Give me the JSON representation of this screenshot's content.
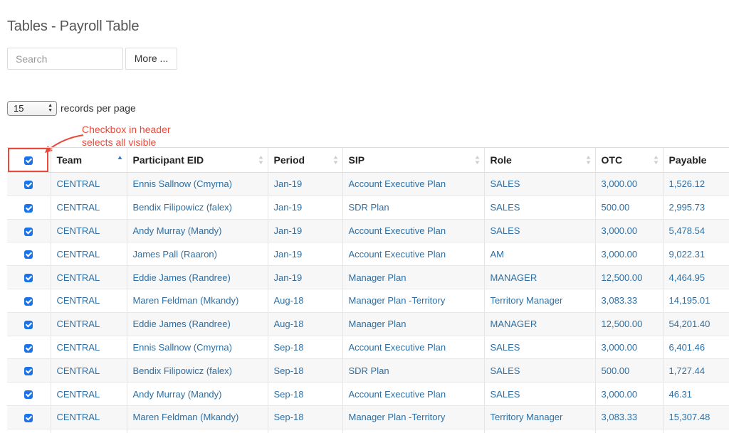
{
  "page_title": "Tables - Payroll Table",
  "search": {
    "placeholder": "Search"
  },
  "more_button": "More ...",
  "page_size": {
    "value": "15",
    "label": "records per page"
  },
  "annotation": {
    "text": "Checkbox in header selects all visible",
    "color": "#e8493b"
  },
  "colors": {
    "link": "#2f6fa3",
    "checkbox": "#1a73e8",
    "callout": "#e8493b"
  },
  "table": {
    "columns": [
      "Team",
      "Participant EID",
      "Period",
      "SIP",
      "Role",
      "OTC",
      "Payable"
    ],
    "sorted_column": "Team",
    "sort_direction": "ascending",
    "rows": [
      [
        "CENTRAL",
        "Ennis Sallnow (Cmyrna)",
        "Jan-19",
        "Account Executive Plan",
        "SALES",
        "3,000.00",
        "1,526.12"
      ],
      [
        "CENTRAL",
        "Bendix Filipowicz (falex)",
        "Jan-19",
        "SDR Plan",
        "SALES",
        "500.00",
        "2,995.73"
      ],
      [
        "CENTRAL",
        "Andy Murray (Mandy)",
        "Jan-19",
        "Account Executive Plan",
        "SALES",
        "3,000.00",
        "5,478.54"
      ],
      [
        "CENTRAL",
        "James Pall (Raaron)",
        "Jan-19",
        "Account Executive Plan",
        "AM",
        "3,000.00",
        "9,022.31"
      ],
      [
        "CENTRAL",
        "Eddie James (Randree)",
        "Jan-19",
        "Manager Plan",
        "MANAGER",
        "12,500.00",
        "4,464.95"
      ],
      [
        "CENTRAL",
        "Maren Feldman (Mkandy)",
        "Aug-18",
        "Manager Plan -Territory",
        "Territory Manager",
        "3,083.33",
        "14,195.01"
      ],
      [
        "CENTRAL",
        "Eddie James (Randree)",
        "Aug-18",
        "Manager Plan",
        "MANAGER",
        "12,500.00",
        "54,201.40"
      ],
      [
        "CENTRAL",
        "Ennis Sallnow (Cmyrna)",
        "Sep-18",
        "Account Executive Plan",
        "SALES",
        "3,000.00",
        "6,401.46"
      ],
      [
        "CENTRAL",
        "Bendix Filipowicz (falex)",
        "Sep-18",
        "SDR Plan",
        "SALES",
        "500.00",
        "1,727.44"
      ],
      [
        "CENTRAL",
        "Andy Murray (Mandy)",
        "Sep-18",
        "Account Executive Plan",
        "SALES",
        "3,000.00",
        "46.31"
      ],
      [
        "CENTRAL",
        "Maren Feldman (Mkandy)",
        "Sep-18",
        "Manager Plan -Territory",
        "Territory Manager",
        "3,083.33",
        "15,307.48"
      ],
      [
        "",
        "",
        "",
        "",
        "",
        "",
        ""
      ]
    ]
  }
}
